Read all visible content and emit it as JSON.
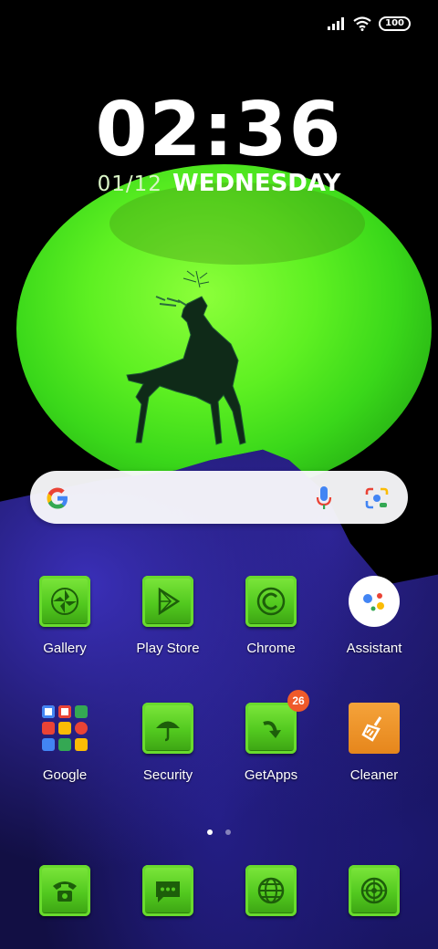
{
  "status_bar": {
    "signal_icon": "signal-bars-icon",
    "wifi_icon": "wifi-icon",
    "battery_level": "100"
  },
  "lockscreen_clock": {
    "time": "02:36",
    "date": "01/12",
    "weekday": "WEDNESDAY"
  },
  "search_widget": {
    "logo": "google-g-icon",
    "mic_icon": "microphone-icon",
    "lens_icon": "camera-lens-icon"
  },
  "home_row_1": [
    {
      "label": "Gallery",
      "icon": "pinwheel-icon"
    },
    {
      "label": "Play Store",
      "icon": "play-triangle-icon"
    },
    {
      "label": "Chrome",
      "icon": "copyright-circle-icon"
    },
    {
      "label": "Assistant",
      "icon": "assistant-dots-icon"
    }
  ],
  "home_row_2": [
    {
      "label": "Google",
      "icon": "google-apps-folder-icon"
    },
    {
      "label": "Security",
      "icon": "umbrella-icon"
    },
    {
      "label": "GetApps",
      "icon": "curved-arrow-icon",
      "badge": "26"
    },
    {
      "label": "Cleaner",
      "icon": "broom-icon"
    }
  ],
  "page_indicator": {
    "count": 2,
    "active": 1
  },
  "dock": [
    {
      "icon": "telephone-icon"
    },
    {
      "icon": "message-bubble-icon"
    },
    {
      "icon": "globe-icon"
    },
    {
      "icon": "target-icon"
    }
  ],
  "colors": {
    "icon_green": "#52c91f",
    "moon_green": "#5ef022",
    "badge_orange": "#ef5a2a",
    "cleaner_orange": "#f5a33a"
  }
}
